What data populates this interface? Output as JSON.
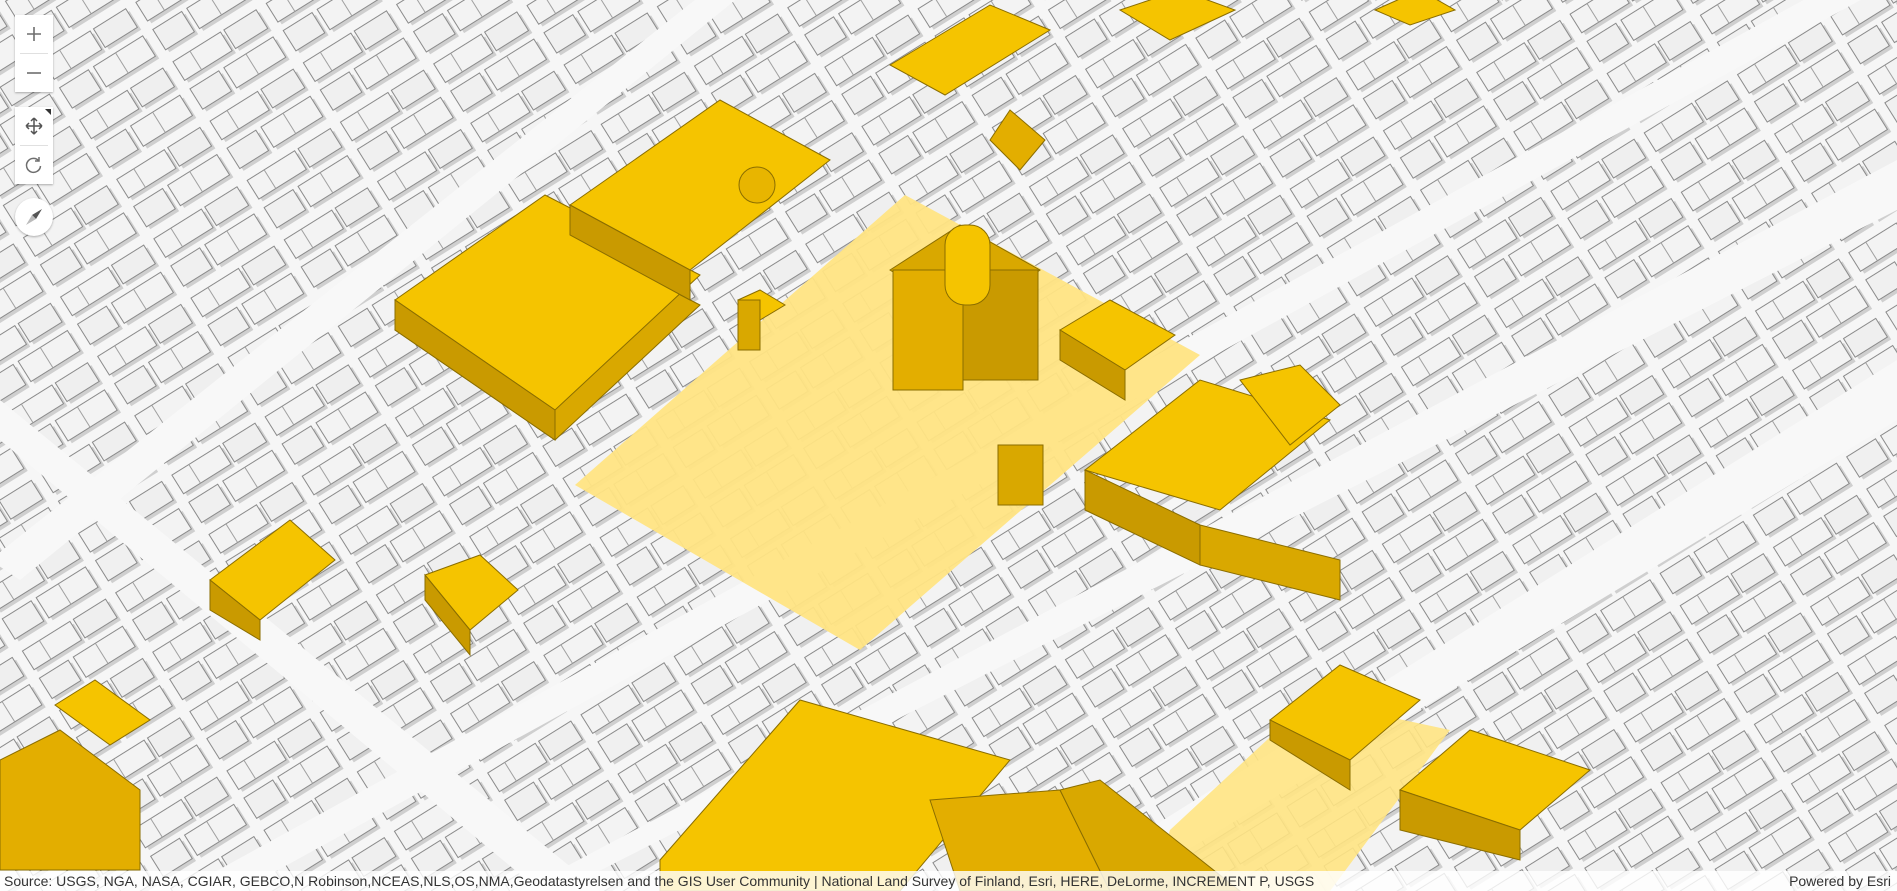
{
  "map": {
    "view_type": "3D city scene",
    "basemap_colors": {
      "ground": "#f6f6f6",
      "building_roof": "#f4f4f4",
      "building_wall": "#d4d4d4",
      "shadow": "#c6c6c6",
      "highlight_roof": "#f5c400",
      "highlight_wall": "#d9a800",
      "highlight_area": "#ffe483"
    }
  },
  "controls": {
    "zoom_in_icon": "plus-icon",
    "zoom_out_icon": "minus-icon",
    "pan_icon": "move-arrows-icon",
    "rotate_icon": "rotate-icon",
    "compass_icon": "compass-icon"
  },
  "attribution": {
    "sources": "Source: USGS, NGA, NASA, CGIAR, GEBCO,N Robinson,NCEAS,NLS,OS,NMA,Geodatastyrelsen and the GIS User Community | National Land Survey of Finland, Esri, HERE, DeLorme, INCREMENT P, USGS",
    "powered_by": "Powered by Esri"
  }
}
